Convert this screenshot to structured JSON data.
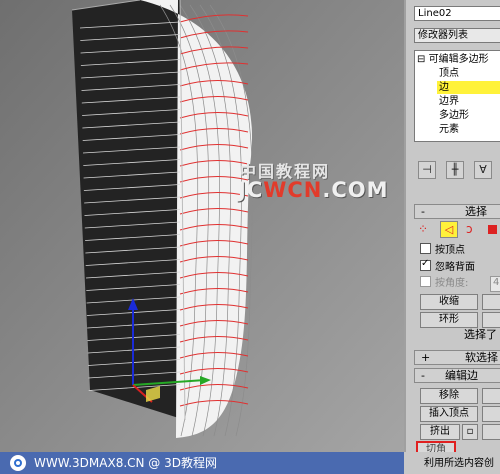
{
  "modifier_panel": {
    "object_name": "Line02",
    "modifier_list": "修改器列表",
    "stack": [
      {
        "prefix": "⊟",
        "label": "可编辑多边形",
        "selected": false
      },
      {
        "prefix": "",
        "label": "顶点",
        "selected": false
      },
      {
        "prefix": "",
        "label": "边",
        "selected": true
      },
      {
        "prefix": "",
        "label": "边界",
        "selected": false
      },
      {
        "prefix": "",
        "label": "多边形",
        "selected": false
      },
      {
        "prefix": "",
        "label": "元素",
        "selected": false
      }
    ],
    "tool_icons": [
      "pin-stack-icon",
      "show-end-result-icon",
      "make-unique-icon"
    ]
  },
  "selection_rollout": {
    "toggle": "-",
    "title": "选择",
    "subobject_icons": [
      "vertex-icon",
      "edge-icon",
      "border-icon",
      "polygon-icon"
    ],
    "by_vertex": "按顶点",
    "ignore_backfacing": "忽略背面",
    "ignore_backfacing_checked": true,
    "by_angle": "按角度:",
    "angle_value": "45.0",
    "shrink": "收缩",
    "ring": "环形",
    "selected_text": "选择了"
  },
  "soft_selection_rollout": {
    "toggle": "+",
    "title": "软选择"
  },
  "edit_edges_rollout": {
    "toggle": "-",
    "title": "编辑边",
    "remove": "移除",
    "insert_vertex": "插入顶点",
    "extrude": "挤出",
    "partial_label": "切角",
    "bottom_text": "利用所选内容创"
  },
  "watermark": {
    "cn": "中国教程网",
    "en_a": "JC",
    "en_b": "WCN",
    "en_c": ".COM"
  },
  "footer": {
    "text": "WWW.3DMAX8.CN @ 3D教程网"
  },
  "colors": {
    "selected": "#fff23a",
    "mesh_line": "#e03030",
    "footer_bg": "#4a6ab0"
  }
}
